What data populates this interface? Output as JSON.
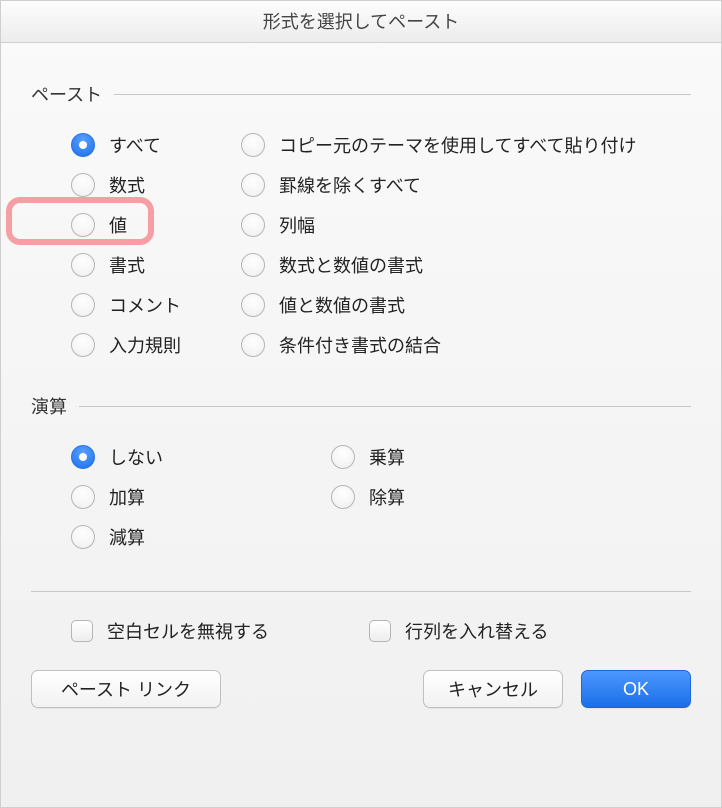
{
  "title": "形式を選択してペースト",
  "groups": {
    "paste": {
      "label": "ペースト",
      "left": [
        {
          "label": "すべて",
          "selected": true
        },
        {
          "label": "数式",
          "selected": false
        },
        {
          "label": "値",
          "selected": false,
          "highlighted": true
        },
        {
          "label": "書式",
          "selected": false
        },
        {
          "label": "コメント",
          "selected": false
        },
        {
          "label": "入力規則",
          "selected": false
        }
      ],
      "right": [
        {
          "label": "コピー元のテーマを使用してすべて貼り付け",
          "selected": false
        },
        {
          "label": "罫線を除くすべて",
          "selected": false
        },
        {
          "label": "列幅",
          "selected": false
        },
        {
          "label": "数式と数値の書式",
          "selected": false
        },
        {
          "label": "値と数値の書式",
          "selected": false
        },
        {
          "label": "条件付き書式の結合",
          "selected": false
        }
      ]
    },
    "operation": {
      "label": "演算",
      "left": [
        {
          "label": "しない",
          "selected": true
        },
        {
          "label": "加算",
          "selected": false
        },
        {
          "label": "減算",
          "selected": false
        }
      ],
      "right": [
        {
          "label": "乗算",
          "selected": false
        },
        {
          "label": "除算",
          "selected": false
        }
      ]
    }
  },
  "checks": {
    "skip_blanks": {
      "label": "空白セルを無視する",
      "checked": false
    },
    "transpose": {
      "label": "行列を入れ替える",
      "checked": false
    }
  },
  "buttons": {
    "paste_link": "ペースト リンク",
    "cancel": "キャンセル",
    "ok": "OK"
  }
}
